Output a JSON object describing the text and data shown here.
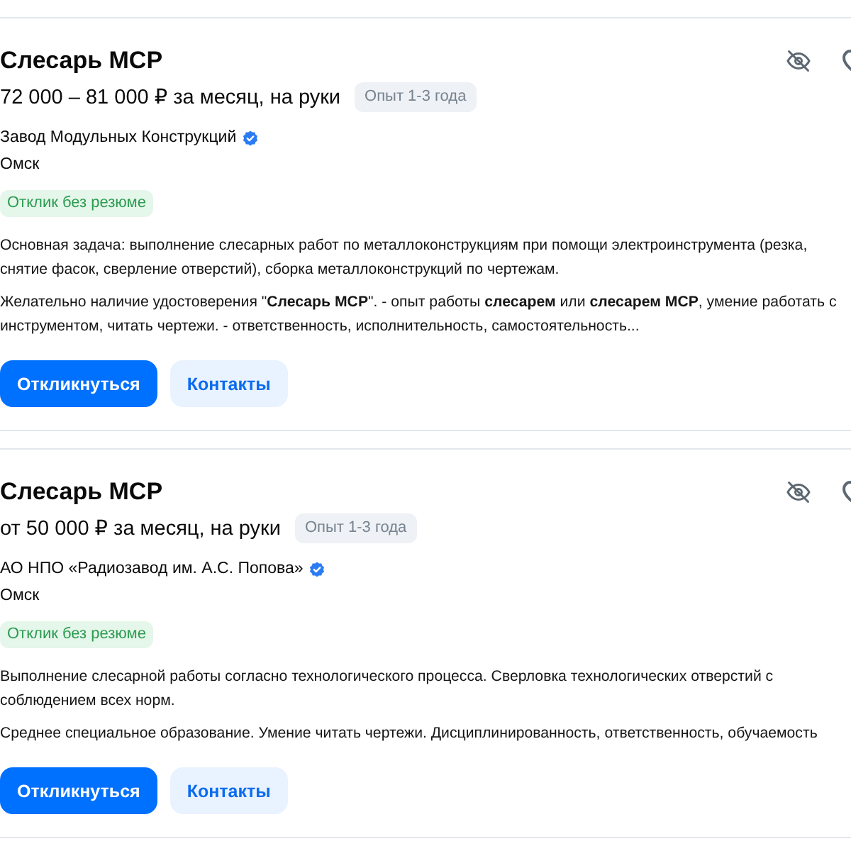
{
  "vacancies": [
    {
      "title": "Слесарь МСР",
      "salary": "72 000 – 81 000 ₽ за месяц, на руки",
      "experience": "Опыт 1-3 года",
      "company": "Завод Модульных Конструкций",
      "company_verified": true,
      "city": "Омск",
      "badge": "Отклик без резюме",
      "snippets": [
        "Основная задача: выполнение слесарных работ по металлоконструкциям при помощи электроинструмента (резка, снятие фасок, сверление отверстий), сборка металлоконструкций по чертежам.",
        "Желательно наличие удостоверения \"**Слесарь МСР**\". - опыт работы **слесарем** или **слесарем МСР**, умение работать с инструментом, читать чертежи. - ответственность, исполнительность, самостоятельность..."
      ],
      "buttons": [
        {
          "label": "Откликнуться",
          "kind": "primary"
        },
        {
          "label": "Контакты",
          "kind": "secondary"
        }
      ]
    },
    {
      "title": "Слесарь МСР",
      "salary": "от 50 000 ₽ за месяц, на руки",
      "experience": "Опыт 1-3 года",
      "company": "АО НПО «Радиозавод им. А.С. Попова»",
      "company_verified": true,
      "city": "Омск",
      "badge": "Отклик без резюме",
      "snippets": [
        "Выполнение слесарной работы согласно технологического процесса. Сверловка технологических отверстий с соблюдением всех норм.",
        "Среднее специальное образование. Умение читать чертежи. Дисциплинированность, ответственность, обучаемость"
      ],
      "buttons": [
        {
          "label": "Откликнуться",
          "kind": "primary"
        },
        {
          "label": "Контакты",
          "kind": "secondary"
        }
      ]
    }
  ]
}
